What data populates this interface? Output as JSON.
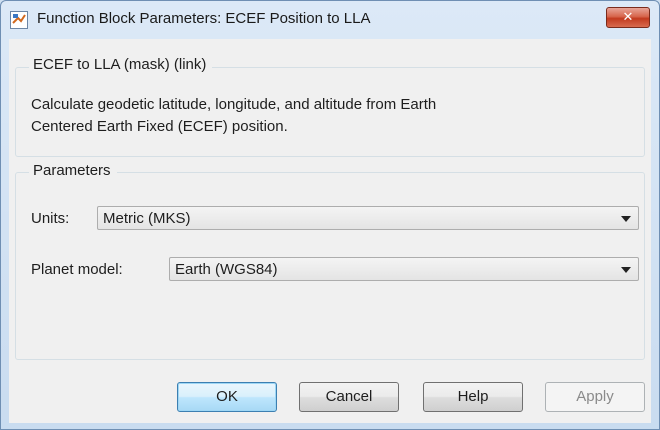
{
  "window": {
    "title": "Function Block Parameters: ECEF Position to LLA",
    "close_label": "✕",
    "app_icon": "simulink-block-icon"
  },
  "mask": {
    "legend": "ECEF to LLA (mask) (link)",
    "description_line1": "Calculate geodetic latitude, longitude, and altitude from Earth",
    "description_line2": "Centered Earth Fixed (ECEF) position."
  },
  "parameters": {
    "legend": "Parameters",
    "units_label": "Units:",
    "units_value": "Metric (MKS)",
    "planet_label": "Planet model:",
    "planet_value": "Earth (WGS84)"
  },
  "buttons": {
    "ok": "OK",
    "cancel": "Cancel",
    "help": "Help",
    "apply": "Apply"
  }
}
